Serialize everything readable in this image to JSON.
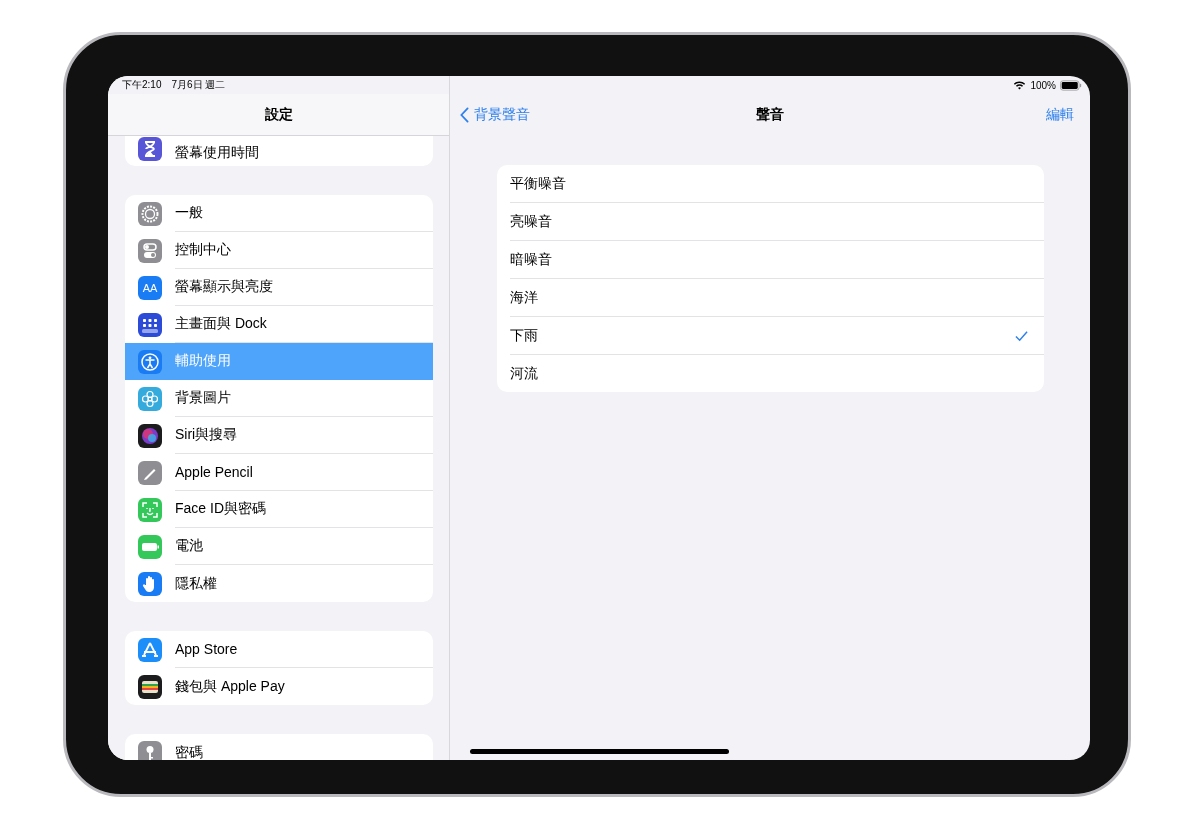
{
  "status_bar": {
    "time": "下午2:10",
    "date": "7月6日 週二",
    "battery": "100%"
  },
  "sidebar": {
    "title": "設定",
    "groups": [
      {
        "items": [
          {
            "label": "螢幕使用時間",
            "selected": false
          }
        ]
      },
      {
        "items": [
          {
            "label": "一般",
            "selected": false
          },
          {
            "label": "控制中心",
            "selected": false
          },
          {
            "label": "螢幕顯示與亮度",
            "selected": false,
            "icon_text": "AA"
          },
          {
            "label": "主畫面與 Dock",
            "selected": false
          },
          {
            "label": "輔助使用",
            "selected": true
          },
          {
            "label": "背景圖片",
            "selected": false
          },
          {
            "label": "Siri與搜尋",
            "selected": false
          },
          {
            "label": "Apple Pencil",
            "selected": false
          },
          {
            "label": "Face ID與密碼",
            "selected": false
          },
          {
            "label": "電池",
            "selected": false
          },
          {
            "label": "隱私權",
            "selected": false
          }
        ]
      },
      {
        "items": [
          {
            "label": "App Store",
            "selected": false
          },
          {
            "label": "錢包與 Apple Pay",
            "selected": false
          }
        ]
      },
      {
        "items": [
          {
            "label": "密碼",
            "selected": false
          }
        ]
      }
    ]
  },
  "detail": {
    "back": "背景聲音",
    "title": "聲音",
    "action": "編輯",
    "options": [
      {
        "label": "平衡噪音",
        "selected": false
      },
      {
        "label": "亮噪音",
        "selected": false
      },
      {
        "label": "暗噪音",
        "selected": false
      },
      {
        "label": "海洋",
        "selected": false
      },
      {
        "label": "下雨",
        "selected": true
      },
      {
        "label": "河流",
        "selected": false
      }
    ]
  }
}
